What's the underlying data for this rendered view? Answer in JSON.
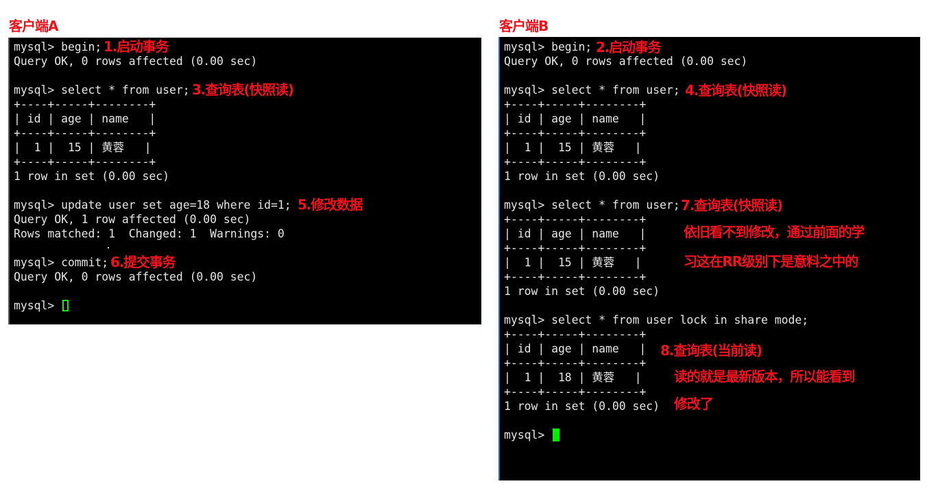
{
  "clients": {
    "a": {
      "label": "客户端A",
      "lines": [
        "mysql> begin;",
        "Query OK, 0 rows affected (0.00 sec)",
        "",
        "mysql> select * from user;",
        "+----+-----+--------+",
        "| id | age | name   |",
        "+----+-----+--------+",
        "|  1 |  15 | 黄蓉   |",
        "+----+-----+--------+",
        "1 row in set (0.00 sec)",
        "",
        "mysql> update user set age=18 where id=1;",
        "Query OK, 1 row affected (0.00 sec)",
        "Rows matched: 1  Changed: 1  Warnings: 0",
        "",
        "mysql> commit;",
        "Query OK, 0 rows affected (0.00 sec)",
        "",
        "mysql> "
      ],
      "notes": [
        "1.启动事务",
        "3.查询表(快照读)",
        "5.修改数据",
        "6.提交事务"
      ],
      "cursor_style": "outline",
      "cursor_color": "#19e619"
    },
    "b": {
      "label": "客户端B",
      "lines": [
        "mysql> begin;",
        "Query OK, 0 rows affected (0.00 sec)",
        "",
        "mysql> select * from user;",
        "+----+-----+--------+",
        "| id | age | name   |",
        "+----+-----+--------+",
        "|  1 |  15 | 黄蓉   |",
        "+----+-----+--------+",
        "1 row in set (0.00 sec)",
        "",
        "mysql> select * from user;",
        "+----+-----+--------+",
        "| id | age | name   |",
        "+----+-----+--------+",
        "|  1 |  15 | 黄蓉   |",
        "+----+-----+--------+",
        "1 row in set (0.00 sec)",
        "",
        "mysql> select * from user lock in share mode;",
        "+----+-----+--------+",
        "| id | age | name   |",
        "+----+-----+--------+",
        "|  1 |  18 | 黄蓉   |",
        "+----+-----+--------+",
        "1 row in set (0.00 sec)",
        "",
        "mysql> "
      ],
      "notes": [
        "2.启动事务",
        "4.查询表(快照读)",
        "7.查询表(快照读)",
        "依旧看不到修改，通过前面的学",
        "习这在RR级别下是意料之中的",
        "8.查询表(当前读)",
        "读的就是最新版本，所以能看到",
        "修改了"
      ],
      "cursor_style": "block",
      "cursor_color": "#00ee00"
    }
  },
  "colors": {
    "annotation": "#f0141e",
    "terminal_bg": "#000000",
    "terminal_text": "#e6e6e6"
  }
}
